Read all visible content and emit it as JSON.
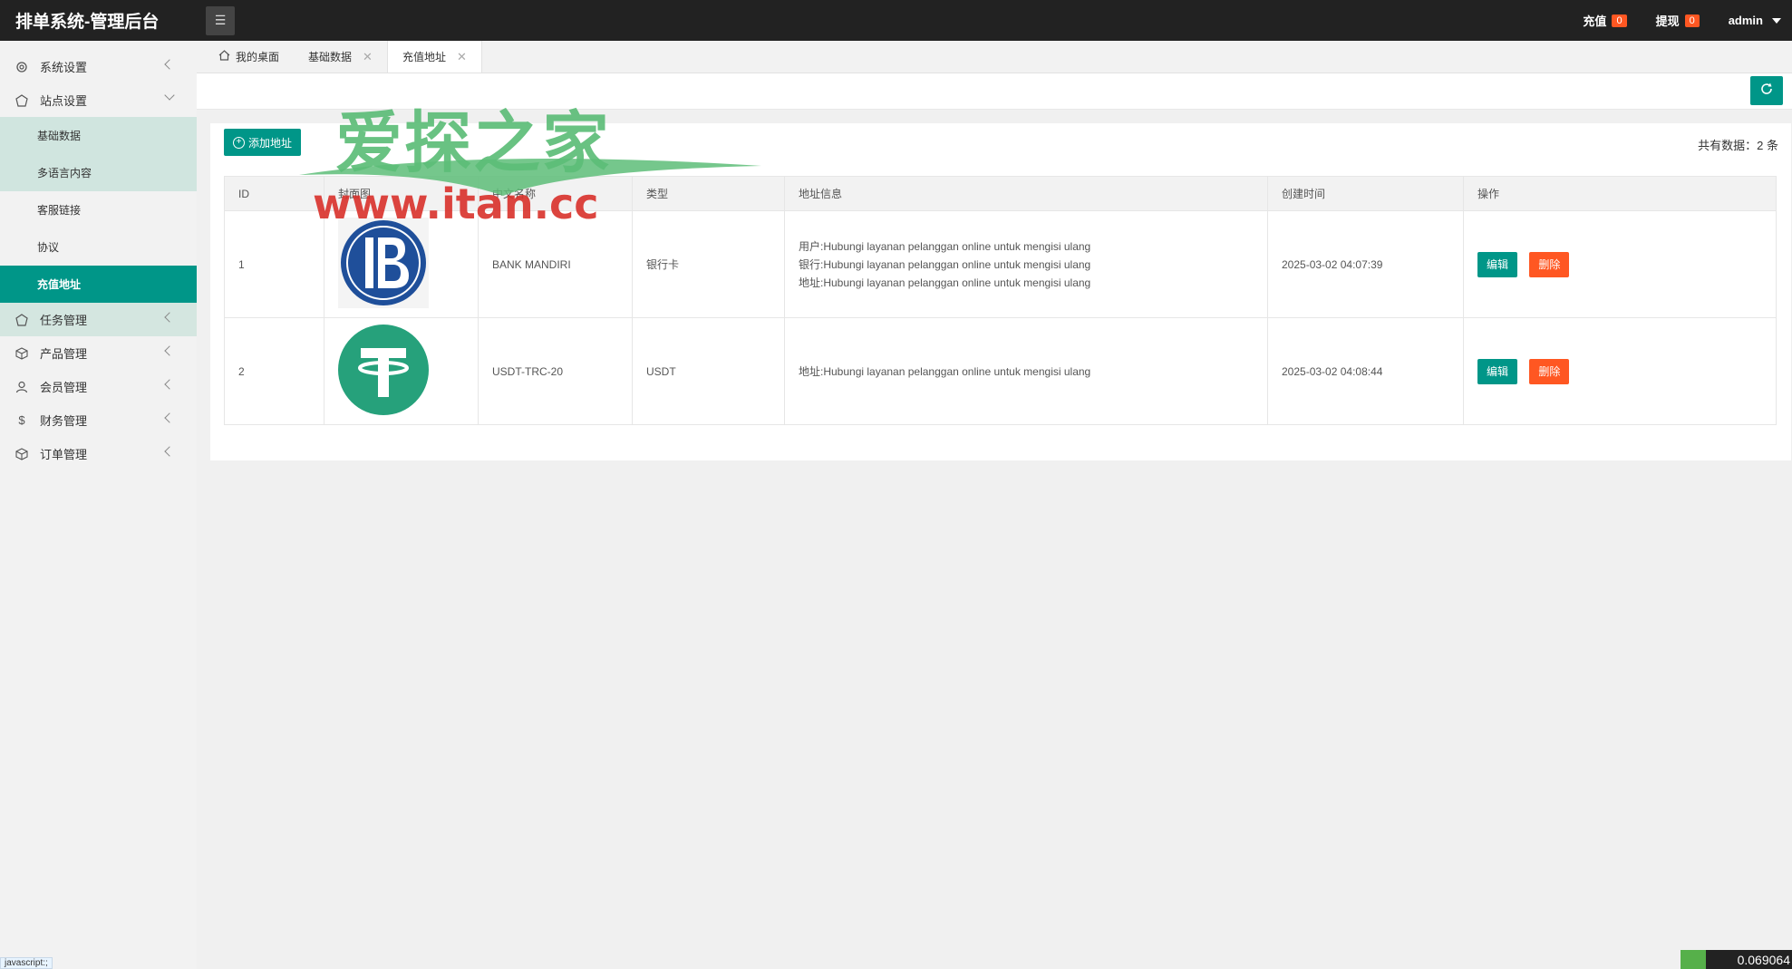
{
  "header": {
    "title": "排单系统-管理后台",
    "recharge_label": "充值",
    "recharge_count": "0",
    "withdraw_label": "提现",
    "withdraw_count": "0",
    "user": "admin"
  },
  "sidebar": {
    "system_settings": "系统设置",
    "site_settings": "站点设置",
    "site_sub": [
      "基础数据",
      "多语言内容",
      "客服链接",
      "协议",
      "充值地址"
    ],
    "task_mgmt": "任务管理",
    "product_mgmt": "产品管理",
    "member_mgmt": "会员管理",
    "finance_mgmt": "财务管理",
    "order_mgmt": "订单管理"
  },
  "tabs": {
    "home": "我的桌面",
    "basic": "基础数据",
    "recharge": "充值地址"
  },
  "toolbar": {
    "add_label": "添加地址",
    "total_label": "共有数据：2 条"
  },
  "table": {
    "headers": [
      "ID",
      "封面图",
      "中文名称",
      "类型",
      "地址信息",
      "创建时间",
      "操作"
    ],
    "rows": [
      {
        "id": "1",
        "name": "BANK MANDIRI",
        "type": "银行卡",
        "addr": [
          "用户:Hubungi layanan pelanggan online untuk mengisi ulang",
          "银行:Hubungi layanan pelanggan online untuk mengisi ulang",
          "地址:Hubungi layanan pelanggan online untuk mengisi ulang"
        ],
        "created": "2025-03-02 04:07:39"
      },
      {
        "id": "2",
        "name": "USDT-TRC-20",
        "type": "USDT",
        "addr": [
          "地址:Hubungi layanan pelanggan online untuk mengisi ulang"
        ],
        "created": "2025-03-02 04:08:44"
      }
    ],
    "edit_label": "编辑",
    "delete_label": "删除"
  },
  "watermark": {
    "cn": "爱探之家",
    "en": "www.itan.cc"
  },
  "footer": {
    "status": "javascript:;",
    "corner_value": "0.069064"
  },
  "colors": {
    "accent": "#009688",
    "danger": "#ff5722",
    "header_bg": "#222222"
  }
}
